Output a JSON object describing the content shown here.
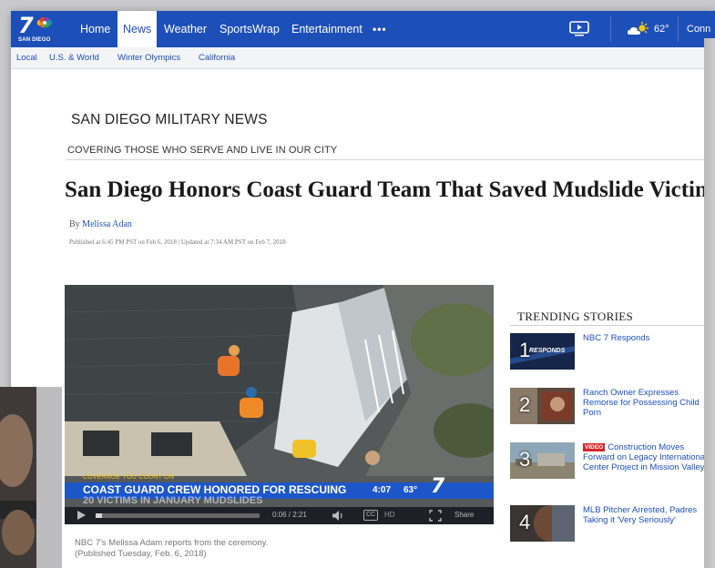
{
  "nav": {
    "logo_text": "7",
    "logo_city": "SAN DIEGO",
    "items": [
      {
        "label": "Home",
        "active": false
      },
      {
        "label": "News",
        "active": true
      },
      {
        "label": "Weather",
        "active": false
      },
      {
        "label": "SportsWrap",
        "active": false
      },
      {
        "label": "Entertainment",
        "active": false
      }
    ],
    "more_label": "•••",
    "temperature": "62°",
    "connect_label": "Conn",
    "tv_icon": "tv-play-icon",
    "weather_icon": "partly-sunny-icon"
  },
  "subnav": {
    "items": [
      "Local",
      "U.S. & World",
      "Winter Olympics",
      "California"
    ]
  },
  "article": {
    "section_title": "SAN DIEGO MILITARY NEWS",
    "section_subtitle": "COVERING THOSE WHO SERVE AND LIVE IN OUR CITY",
    "headline": "San Diego Honors Coast Guard Team That Saved Mudslide Victims",
    "by_prefix": "By",
    "author": "Melissa Adan",
    "published": "Published at 6:45 PM PST on Feb 6, 2018 | Updated at 7:34 AM PST on Feb 7, 2018"
  },
  "video": {
    "kicker": "COVERAGE YOU COUNT ON",
    "headline_line1": "COAST GUARD CREW HONORED FOR RESCUING",
    "headline_line2": "20 VICTIMS IN JANUARY MUDSLIDES",
    "clock": "4:07",
    "temp": "63°",
    "logo": "7",
    "time_display": "0:06 / 2:21",
    "progress": 0.04,
    "cc_label": "CC",
    "hd_label": "HD",
    "share_label": "Share",
    "caption_line1": "NBC 7's Melissa Adam reports from the ceremony.",
    "caption_line2": "(Published Tuesday, Feb. 6, 2018)"
  },
  "trending": {
    "title": "TRENDING STORIES",
    "items": [
      {
        "num": "1",
        "thumb_text": "RESPONDS",
        "text": "NBC 7 Responds",
        "badge": ""
      },
      {
        "num": "2",
        "thumb_text": "",
        "text": "Ranch Owner Expresses Remorse for Possessing Child Porn",
        "badge": ""
      },
      {
        "num": "3",
        "thumb_text": "",
        "text": "Construction Moves Forward on Legacy International Center Project in Mission Valley",
        "badge": "VIDEO"
      },
      {
        "num": "4",
        "thumb_text": "",
        "text": "MLB Pitcher Arrested, Padres Taking it 'Very Seriously'",
        "badge": ""
      }
    ]
  },
  "colors": {
    "brand_blue": "#1d4fb8",
    "video_bar_blue": "#1d56c8",
    "kicker_yellow": "#f3c21a",
    "badge_red": "#d7262b"
  }
}
